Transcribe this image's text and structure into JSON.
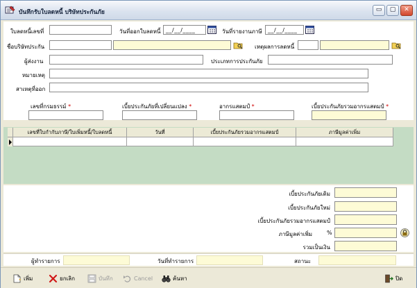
{
  "window": {
    "title": "บันทึกรับใบลดหนี้ บริษัทประกันภัย",
    "minimize_glyph": "▭",
    "maximize_glyph": "▢",
    "close_glyph": "✕"
  },
  "form": {
    "credit_note_no_label": "ใบลดหนี้เลขที่",
    "issue_date_label": "วันที่ออกใบลดหนี้",
    "issue_date_value": "__/__/____",
    "tax_report_date_label": "วันที่รายงานภาษี",
    "tax_report_date_value": "__/__/____",
    "insurer_name_label": "ชื่อบริษัทประกัน",
    "credit_reason_label": "เหตุผลการลดหนี้",
    "sender_label": "ผู้ส่งงาน",
    "insurance_type_label": "ประเภทการประกันภัย",
    "remark_label": "หมายเหตุ",
    "issue_reason_label": "สาเหตุที่ออก",
    "policy_no_label": "เลขที่กรมธรรม์",
    "changed_premium_label": "เบี้ยประกันภัยที่เปลี่ยนแปลง",
    "stamp_duty_label": "อากรแสตมป์",
    "total_premium_stamp_label": "เบี้ยประกันภัยรวมอากรแสตมป์",
    "required_mark": "*"
  },
  "grid": {
    "columns": [
      "เลขที่ใบกำกับภาษี/ใบเพิ่มหนี้/ใบลดหนี้",
      "วันที่",
      "เบี้ยประกันภัยรวมอากรแสตมป์",
      "ภาษีมูลค่าเพิ่ม"
    ]
  },
  "summary": {
    "original_premium_label": "เบี้ยประกันภัยเดิม",
    "new_premium_label": "เบี้ยประกันภัยใหม่",
    "premium_with_stamp_label": "เบี้ยประกันภัยรวมอากรแสตมป์",
    "vat_label": "ภาษีมูลค่าเพิ่ม",
    "vat_pct": "%",
    "grand_total_label": "รวมเป็นเงิน"
  },
  "info": {
    "creator_label": "ผู้ทำรายการ",
    "created_date_label": "วันที่ทำรายการ",
    "status_label": "สถานะ"
  },
  "toolbar": {
    "add_label": "เพิ่ม",
    "delete_label": "ยกเลิก",
    "save_label": "บันทึก",
    "cancel_label": "Cancel",
    "search_label": "ค้นหา",
    "close_label": "ปิด"
  },
  "colors": {
    "required": "#d00000",
    "readonly_field": "#fdfbd6",
    "grid_background": "#c4dcc4"
  }
}
